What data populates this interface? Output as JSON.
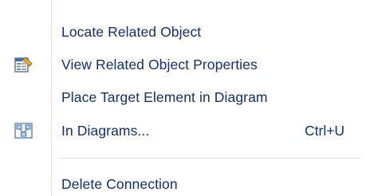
{
  "menu": {
    "items": [
      {
        "label": "Locate Related Object",
        "shortcut": "",
        "icon": ""
      },
      {
        "label": "View Related Object Properties",
        "shortcut": "",
        "icon": "properties-icon"
      },
      {
        "label": "Place Target Element in Diagram",
        "shortcut": "",
        "icon": ""
      },
      {
        "label": "In Diagrams...",
        "shortcut": "Ctrl+U",
        "icon": "diagram-icon"
      },
      {
        "label": "Delete Connection",
        "shortcut": "",
        "icon": ""
      }
    ]
  },
  "colors": {
    "text": "#10306e",
    "background": "#ffffff",
    "separator": "#e0e0e0"
  }
}
